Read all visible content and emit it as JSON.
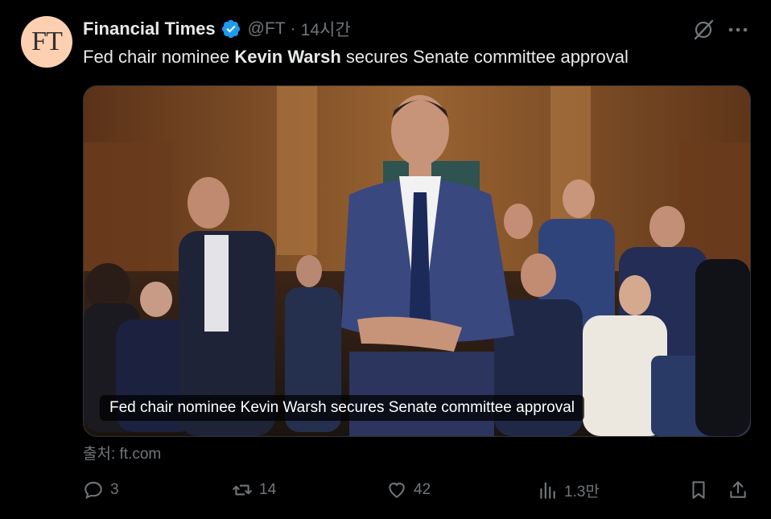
{
  "tweet": {
    "avatar_text": "FT",
    "author_name": "Financial Times",
    "handle": "@FT",
    "separator": "·",
    "time": "14시간",
    "text_before": "Fed chair nominee ",
    "text_bold": "Kevin Warsh",
    "text_after": " secures Senate committee approval"
  },
  "card": {
    "caption": "Fed chair nominee Kevin Warsh secures Senate committee approval",
    "source": "출처: ft.com"
  },
  "actions": {
    "replies": "3",
    "reposts": "14",
    "likes": "42",
    "views": "1.3만"
  },
  "colors": {
    "background": "#000000",
    "text": "#e7e9ea",
    "muted": "#71767b",
    "verified": "#1d9bf0",
    "avatar_bg": "#fcd0b1"
  },
  "icons": [
    "verified-badge-icon",
    "grok-icon",
    "more-icon",
    "reply-icon",
    "repost-icon",
    "like-icon",
    "views-icon",
    "bookmark-icon",
    "share-icon"
  ]
}
